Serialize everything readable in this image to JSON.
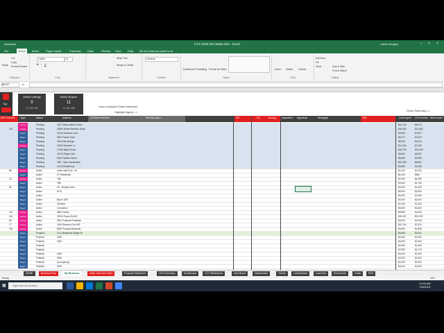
{
  "window": {
    "title": "CTX 2019 DIA-Mabe.xlsx - Excel",
    "user": "Calvin Morgan",
    "autosave": "AutoSave"
  },
  "ribbon_tabs": [
    "File",
    "Home",
    "Insert",
    "Page Layout",
    "Formulas",
    "Data",
    "Review",
    "View",
    "Help",
    "Tell me what you want to do"
  ],
  "ribbon": {
    "clipboard": {
      "paste": "Paste",
      "cut": "Cut",
      "copy": "Copy",
      "format_painter": "Format Painter",
      "label": "Clipboard"
    },
    "font": {
      "name": "Calibri",
      "size": "11",
      "label": "Font"
    },
    "alignment": {
      "wrap": "Wrap Text",
      "merge": "Merge & Center",
      "label": "Alignment"
    },
    "number": {
      "format": "General",
      "label": "Number"
    },
    "styles": {
      "conditional": "Conditional Formatting",
      "format_table": "Format as Table",
      "cell_styles": "Cell Styles",
      "label": "Styles"
    },
    "cells": {
      "insert": "Insert",
      "delete": "Delete",
      "format": "Format",
      "label": "Cells"
    },
    "editing": {
      "autosum": "AutoSum",
      "fill": "Fill",
      "clear": "Clear",
      "sort": "Sort & Filter",
      "find": "Find & Select",
      "label": "Editing"
    }
  },
  "formula_bar": {
    "name_box": "BK127",
    "fx": "fx"
  },
  "dashboard": {
    "home_label": "Top",
    "active_listings": {
      "label": "Active Listings",
      "count": "0",
      "volume": "$1,306,897",
      "sub": "$45,675"
    },
    "active_buyers": {
      "label": "Active Buyers",
      "count": "11",
      "volume": "$4,183,880",
      "sub": "$127,252"
    },
    "link": "How to pinpoint Team Members",
    "highlight": "Highlight Agent -->",
    "show_summary": "Show Summary-->",
    "totals_a": "$4,963",
    "totals_b": "$1,327"
  },
  "header": [
    "DEPTH",
    "DOM",
    "Type",
    "Status",
    "Address",
    "CE/Team Member",
    "Monthly Split 1",
    "CE/Team Member",
    "Monthly Split 2",
    "Listing Broker",
    "Buyer Agent",
    "Status",
    "SO",
    "SO",
    "Deactive",
    "Closing",
    "Inspection",
    "Appraisal",
    "Mortgage",
    "Closing",
    "Title",
    "Loan",
    "Lead Agent",
    "GCI Income",
    "Net Income"
  ],
  "rows": [
    {
      "dom": "",
      "type": "Listing",
      "status": "Pending",
      "addr": "3311 Sherry Ashlee Circle",
      "lead": "$16,125",
      "gci": "$8,073"
    },
    {
      "dom": "120",
      "type": "Listing",
      "status": "Pending",
      "addr": "20505 Robert Bamboo Road",
      "lead": "$25,360",
      "gci": "$14,963"
    },
    {
      "dom": "",
      "type": "Buyer",
      "status": "Pending",
      "addr": "14215 Gravelse Lane",
      "lead": "$3,699",
      "gci": "$1,907"
    },
    {
      "dom": "",
      "type": "Buyer",
      "status": "Pending",
      "addr": "9001 Farrah Trace",
      "lead": "$5,070",
      "gci": "$2,519"
    },
    {
      "dom": "",
      "type": "Buyer",
      "status": "Pending",
      "addr": "3400 Alfa Springs",
      "lead": "$5,590",
      "gci": "$3,034"
    },
    {
      "dom": "",
      "type": "Listing",
      "status": "Pending",
      "addr": "13519 Delcosm Ln",
      "lead": "$14,330",
      "gci": "$7,305"
    },
    {
      "dom": "",
      "type": "Buyer",
      "status": "Pending",
      "addr": "14760 Black Pointe",
      "lead": "$26,739",
      "gci": "$13,209"
    },
    {
      "dom": "",
      "type": "Buyer",
      "status": "Pending",
      "addr": "18715 Pepper Dell",
      "lead": "$5,650",
      "gci": "$2,837"
    },
    {
      "dom": "",
      "type": "Buyer",
      "status": "Pending",
      "addr": "9400 Flowers Grace",
      "lead": "$5,899",
      "gci": "$2,966"
    },
    {
      "dom": "",
      "type": "Buyer",
      "status": "Pending",
      "addr": "TBD - New Construction",
      "lead": "$10,980",
      "gci": "$5,587"
    },
    {
      "dom": "",
      "type": "Buyer",
      "status": "Pending",
      "addr": "Lot 4233 Alchemy",
      "lead": "$4,850",
      "gci": "$2,425"
    },
    {
      "dom": "86",
      "type": "Listing",
      "status": "Active",
      "addr": "Lease with Exta - 3k",
      "lead": "$1,000",
      "gci": "$1,000"
    },
    {
      "dom": "",
      "type": "Buyer",
      "status": "Active",
      "addr": "3+ Residential",
      "lead": "$1,000",
      "gci": "$500"
    },
    {
      "dom": "16",
      "type": "Listing",
      "status": "Active",
      "addr": "TBD",
      "lead": "$7,500",
      "gci": "$4,295"
    },
    {
      "dom": "",
      "type": "Buyer",
      "status": "Active",
      "addr": "TBD",
      "lead": "$3,000",
      "gci": "$1,750"
    },
    {
      "dom": "56",
      "type": "Buyer",
      "status": "Active",
      "addr": "2K - Alvarino Area",
      "lead": "$2,900",
      "gci": "$1,425"
    },
    {
      "dom": "",
      "type": "Buyer",
      "status": "Active",
      "addr": "HCD",
      "lead": "$5,000",
      "gci": "$2,500"
    },
    {
      "dom": "",
      "type": "Buyer",
      "status": "Active",
      "addr": "",
      "lead": "$4,500",
      "gci": "$2,280"
    },
    {
      "dom": "",
      "type": "Buyer",
      "status": "Active",
      "addr": "Bay in 3DM",
      "lead": "$4,000",
      "gci": "$2,000"
    },
    {
      "dom": "",
      "type": "Buyer",
      "status": "Active",
      "addr": "Olmsted",
      "lead": "$2,100",
      "gci": "$1,050"
    },
    {
      "dom": "",
      "type": "Buyer",
      "status": "Active",
      "addr": "Commerce",
      "lead": "$6,000",
      "gci": "$3,000"
    },
    {
      "dom": "142",
      "type": "Listing",
      "status": "Active",
      "addr": "3800 Timber",
      "lead": "$8,988",
      "gci": "$4,494"
    },
    {
      "dom": "115",
      "type": "Listing",
      "status": "Active",
      "addr": "2021k Pecan St #413",
      "lead": "$26,187",
      "gci": "$13,092"
    },
    {
      "dom": "69",
      "type": "Listing",
      "status": "Active",
      "addr": "3531 Poiamisa Poiamise",
      "lead": "$5,093",
      "gci": "$2,549"
    },
    {
      "dom": "77",
      "type": "Listing",
      "status": "Active",
      "addr": "2440 Ravenas Ford DR",
      "lead": "$15,750",
      "gci": "$7,875"
    },
    {
      "dom": "149",
      "type": "Listing",
      "status": "Active",
      "addr": "8000 Pecanty Manuuals",
      "lead": "$3,693",
      "gci": "$1,845"
    },
    {
      "dom": "",
      "type": "Buyer",
      "status": "Prospect",
      "addr": "1111 Westbrook Village Dr",
      "lead": "$4,865",
      "gci": "$3,201"
    },
    {
      "dom": "",
      "type": "Buyer",
      "status": "Potential",
      "addr": "2000",
      "lead": "$4,500",
      "gci": "$2,250"
    },
    {
      "dom": "",
      "type": "Buyer",
      "status": "Potential",
      "addr": "2000",
      "lead": "$4,500",
      "gci": "$2,250"
    },
    {
      "dom": "",
      "type": "Buyer",
      "status": "Potential",
      "addr": "",
      "lead": "$2,900",
      "gci": "$1,450"
    },
    {
      "dom": "",
      "type": "Buyer",
      "status": "Potential",
      "addr": "",
      "lead": "$2,950",
      "gci": "$1,475"
    },
    {
      "dom": "",
      "type": "Buyer",
      "status": "Potential",
      "addr": "2000",
      "lead": "$3,000",
      "gci": "$1,500"
    },
    {
      "dom": "",
      "type": "Buyer",
      "status": "Potential",
      "addr": "2000",
      "lead": "$3,000",
      "gci": "$1,500"
    },
    {
      "dom": "",
      "type": "Buyer",
      "status": "Potential",
      "addr": "(no ongoing)",
      "lead": "$4,000",
      "gci": "$2,000"
    },
    {
      "dom": "",
      "type": "Buyer",
      "status": "Potential",
      "addr": "2000",
      "lead": "$3,000",
      "gci": "$1,500"
    }
  ],
  "sheet_tabs": [
    {
      "label": "HOME",
      "color": "#404040"
    },
    {
      "label": "Business Plan",
      "color": "#e02020"
    },
    {
      "label": "My Business",
      "color": "#ffffff"
    },
    {
      "label": "Daily Lead Gen Entry",
      "color": "#e02020"
    },
    {
      "label": "Financial Statement",
      "color": "#404040"
    },
    {
      "label": "CEO Summary",
      "color": "#404040"
    },
    {
      "label": "Scoreboard",
      "color": "#404040"
    },
    {
      "label": "CTX Whiteboard",
      "color": "#404040"
    },
    {
      "label": "Sold Board",
      "color": "#404040"
    },
    {
      "label": "Dashboards",
      "color": "#404040"
    },
    {
      "label": "Trends",
      "color": "#404040"
    },
    {
      "label": "Leaderboard",
      "color": "#404040"
    },
    {
      "label": "Lead Gen",
      "color": "#404040"
    },
    {
      "label": "Scorecards",
      "color": "#404040"
    },
    {
      "label": "Goals",
      "color": "#404040"
    },
    {
      "label": "PDS",
      "color": "#404040"
    }
  ],
  "status_bar": {
    "ready": "Ready",
    "zoom": "40%"
  },
  "taskbar": {
    "search": "Type here to search",
    "time": "11:00 AM",
    "date": "1/9/2019"
  },
  "colors": {
    "excel_green": "#217346",
    "header_dark": "#404040",
    "red": "#e02020",
    "pink": "#e91e8c",
    "blue": "#2f5f9a"
  }
}
